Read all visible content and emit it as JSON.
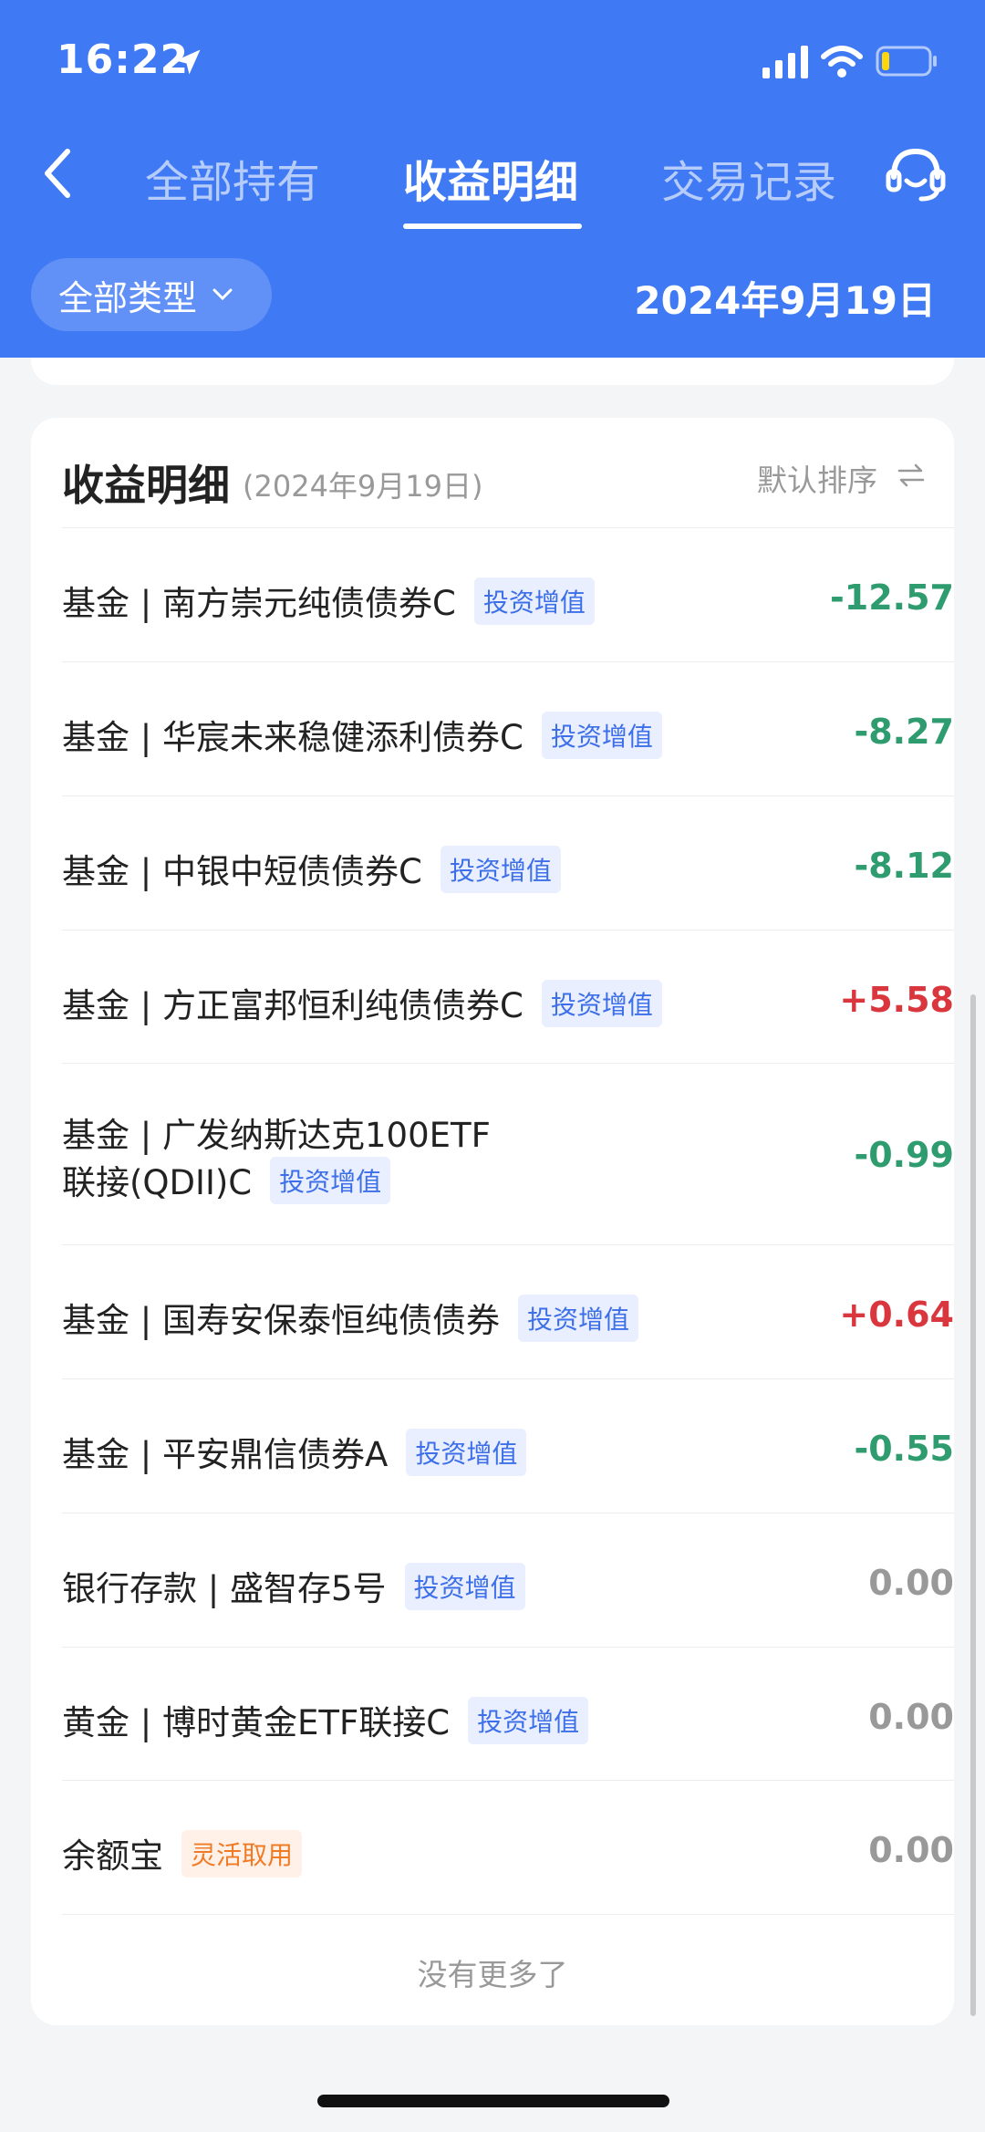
{
  "status_bar": {
    "time": "16:22"
  },
  "nav": {
    "tabs": [
      {
        "label": "全部持有"
      },
      {
        "label": "收益明细"
      },
      {
        "label": "交易记录"
      }
    ],
    "active_tab": "收益明细"
  },
  "filter": {
    "type_label": "全部类型",
    "date": "2024年9月19日"
  },
  "card": {
    "title": "收益明细",
    "date": "(2024年9月19日)",
    "sort_label": "默认排序",
    "items": [
      {
        "name": "基金 | 南方崇元纯债债券C",
        "tag": "投资增值",
        "value": "-12.57",
        "sign": "neg"
      },
      {
        "name": "基金 | 华宸未来稳健添利债券C",
        "tag": "投资增值",
        "value": "-8.27",
        "sign": "neg"
      },
      {
        "name": "基金 | 中银中短债债券C",
        "tag": "投资增值",
        "value": "-8.12",
        "sign": "neg"
      },
      {
        "name": "基金 | 方正富邦恒利纯债债券C",
        "tag": "投资增值",
        "value": "+5.58",
        "sign": "pos"
      },
      {
        "name_line1": "基金 | 广发纳斯达克100ETF",
        "name_line2": "联接(QDII)C",
        "tag": "投资增值",
        "value": "-0.99",
        "sign": "neg"
      },
      {
        "name": "基金 | 国寿安保泰恒纯债债券",
        "tag": "投资增值",
        "value": "+0.64",
        "sign": "pos"
      },
      {
        "name": "基金 | 平安鼎信债券A",
        "tag": "投资增值",
        "value": "-0.55",
        "sign": "neg"
      },
      {
        "name": "银行存款 | 盛智存5号",
        "tag": "投资增值",
        "value": "0.00",
        "sign": "zero"
      },
      {
        "name": "黄金 | 博时黄金ETF联接C",
        "tag": "投资增值",
        "value": "0.00",
        "sign": "zero"
      },
      {
        "name": "余额宝",
        "tag": "灵活取用",
        "value": "0.00",
        "sign": "zero"
      }
    ],
    "footer": "没有更多了"
  }
}
